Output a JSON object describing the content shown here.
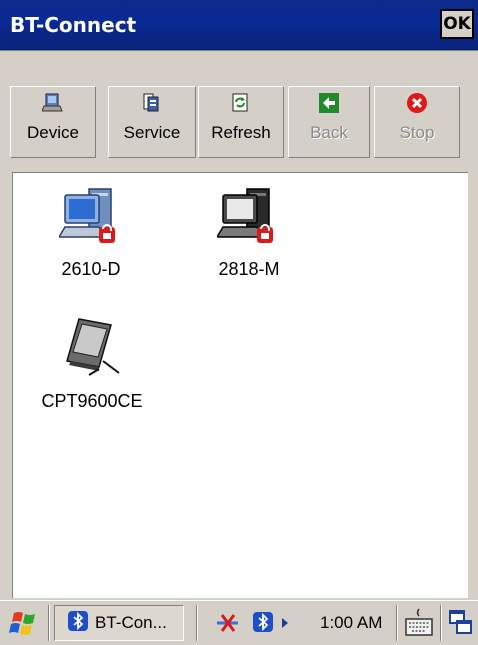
{
  "window": {
    "title": "BT-Connect",
    "ok_label": "OK"
  },
  "toolbar": {
    "buttons": [
      {
        "label": "Device",
        "icon": "device-icon",
        "enabled": true
      },
      {
        "label": "Service",
        "icon": "service-icon",
        "enabled": true
      },
      {
        "label": "Refresh",
        "icon": "refresh-icon",
        "enabled": true
      },
      {
        "label": "Back",
        "icon": "back-arrow-icon",
        "enabled": false
      },
      {
        "label": "Stop",
        "icon": "stop-icon",
        "enabled": false
      }
    ]
  },
  "devices": [
    {
      "name": "2610-D",
      "icon": "desktop-computer-locked-icon"
    },
    {
      "name": "2818-M",
      "icon": "desktop-computer-locked-icon"
    },
    {
      "name": "CPT9600CE",
      "icon": "pda-icon"
    }
  ],
  "taskbar": {
    "task_label": "BT-Con...",
    "clock": "1:00 AM"
  },
  "colors": {
    "titlebar": "#0a2a94",
    "background": "#d4d0c8",
    "content": "#ffffff"
  }
}
